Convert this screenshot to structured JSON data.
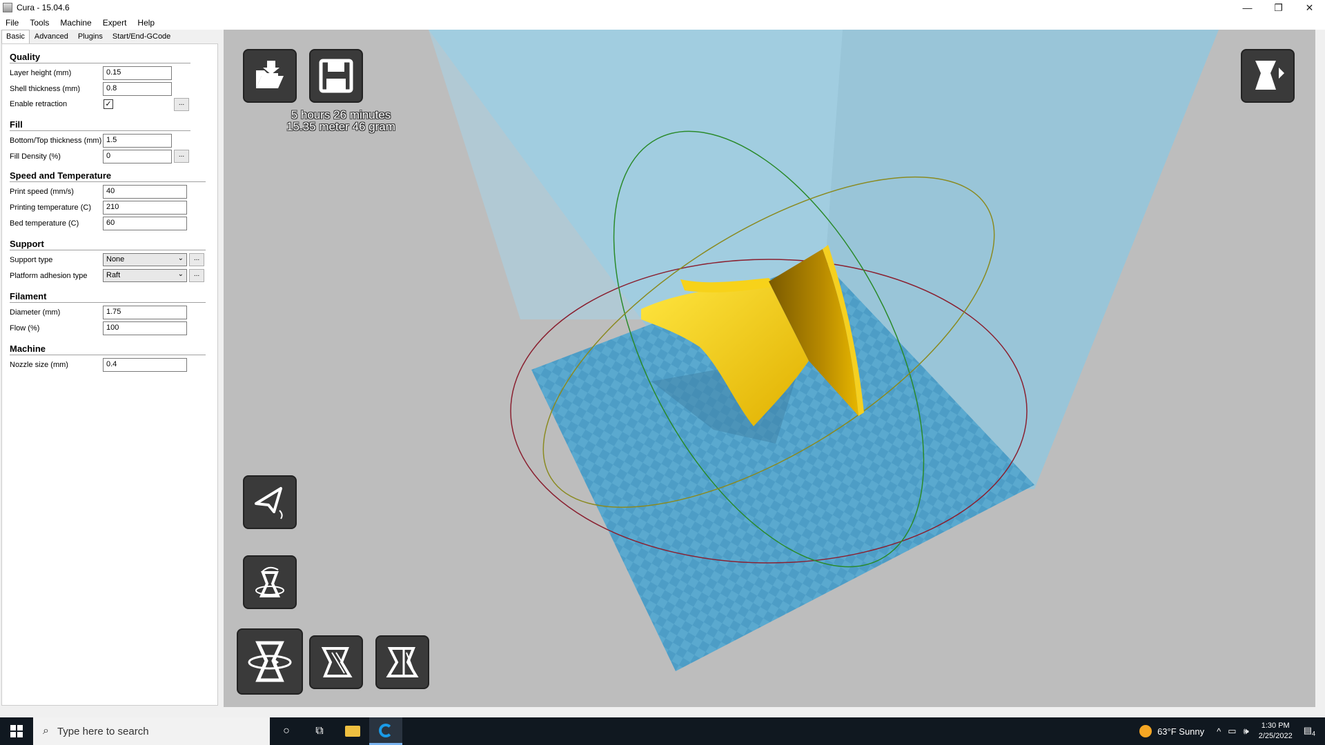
{
  "window": {
    "title": "Cura - 15.04.6",
    "controls": [
      "—",
      "❐",
      "✕"
    ]
  },
  "menu": [
    "File",
    "Tools",
    "Machine",
    "Expert",
    "Help"
  ],
  "tabs": [
    "Basic",
    "Advanced",
    "Plugins",
    "Start/End-GCode"
  ],
  "settings": {
    "quality": {
      "title": "Quality",
      "layer_height_label": "Layer height (mm)",
      "layer_height": "0.15",
      "shell_thickness_label": "Shell thickness (mm)",
      "shell_thickness": "0.8",
      "retraction_label": "Enable retraction",
      "retraction_checked": "✓"
    },
    "fill": {
      "title": "Fill",
      "bottom_top_label": "Bottom/Top thickness (mm)",
      "bottom_top": "1.5",
      "density_label": "Fill Density (%)",
      "density": "0"
    },
    "speed": {
      "title": "Speed and Temperature",
      "print_speed_label": "Print speed (mm/s)",
      "print_speed": "40",
      "print_temp_label": "Printing temperature (C)",
      "print_temp": "210",
      "bed_temp_label": "Bed temperature (C)",
      "bed_temp": "60"
    },
    "support": {
      "title": "Support",
      "type_label": "Support type",
      "type": "None",
      "adhesion_label": "Platform adhesion type",
      "adhesion": "Raft"
    },
    "filament": {
      "title": "Filament",
      "diameter_label": "Diameter (mm)",
      "diameter": "1.75",
      "flow_label": "Flow (%)",
      "flow": "100"
    },
    "machine": {
      "title": "Machine",
      "nozzle_label": "Nozzle size (mm)",
      "nozzle": "0.4"
    },
    "dots": "..."
  },
  "viewport": {
    "print_time": "5 hours 26 minutes",
    "print_material": "15.35 meter 46 gram"
  },
  "taskbar": {
    "search_placeholder": "Type here to search",
    "weather": "63°F  Sunny",
    "time": "1:30 PM",
    "date": "2/25/2022",
    "notifications": "4"
  },
  "colors": {
    "model": "#f2c200",
    "bed": "#5aa9cf",
    "volume": "#8ec8e2",
    "tool_button": "#3a3a3a"
  }
}
